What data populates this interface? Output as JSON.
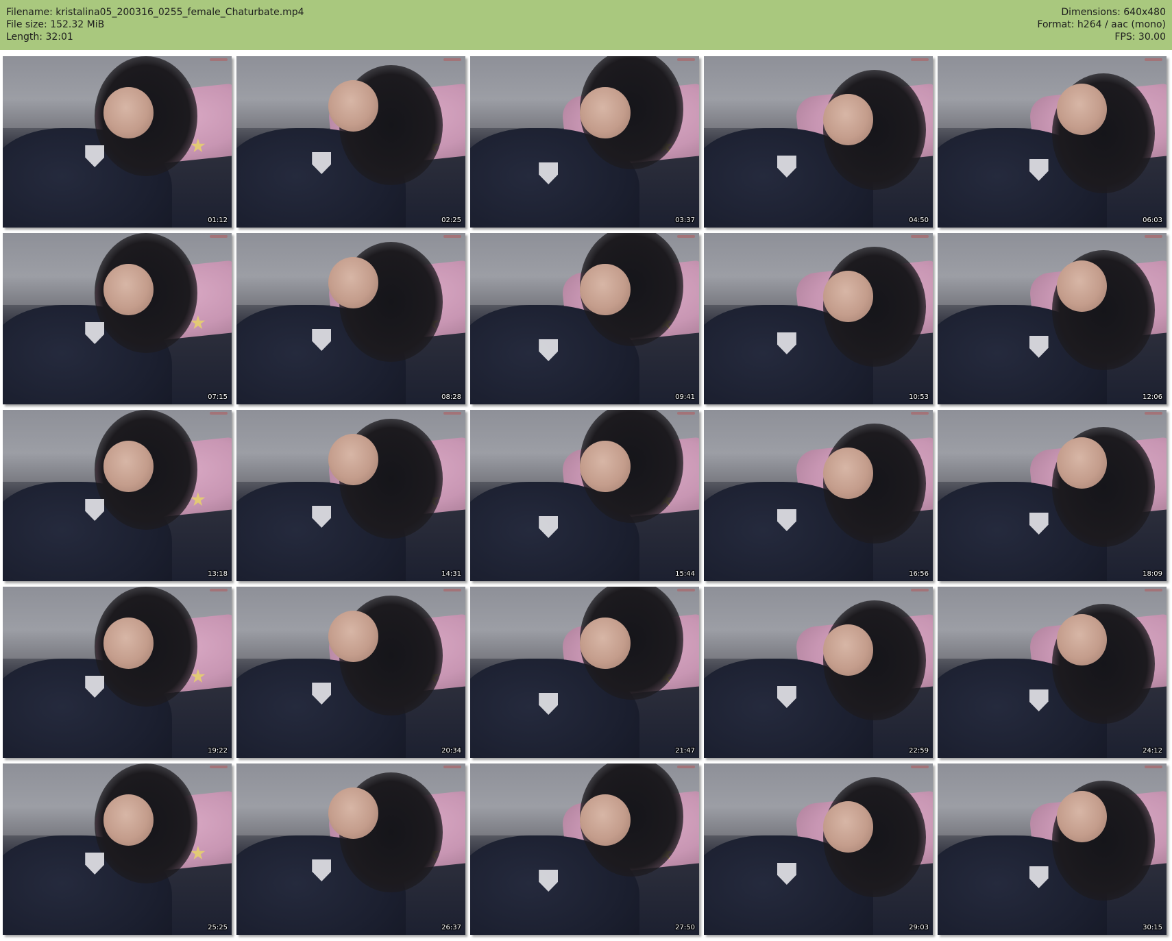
{
  "header": {
    "filename": "Filename: kristalina05_200316_0255_female_Chaturbate.mp4",
    "filesize": "File size: 152.32 MiB",
    "length": "Length: 32:01",
    "dimensions": "Dimensions: 640x480",
    "format": "Format: h264 / aac (mono)",
    "fps": "FPS: 30.00"
  },
  "colors": {
    "header_bg": "#a9c87e",
    "page_bg": "#ffffff"
  },
  "thumbnails": [
    {
      "time": "01:12"
    },
    {
      "time": "02:25"
    },
    {
      "time": "03:37"
    },
    {
      "time": "04:50"
    },
    {
      "time": "06:03"
    },
    {
      "time": "07:15"
    },
    {
      "time": "08:28"
    },
    {
      "time": "09:41"
    },
    {
      "time": "10:53"
    },
    {
      "time": "12:06"
    },
    {
      "time": "13:18"
    },
    {
      "time": "14:31"
    },
    {
      "time": "15:44"
    },
    {
      "time": "16:56"
    },
    {
      "time": "18:09"
    },
    {
      "time": "19:22"
    },
    {
      "time": "20:34"
    },
    {
      "time": "21:47"
    },
    {
      "time": "22:59"
    },
    {
      "time": "24:12"
    },
    {
      "time": "25:25"
    },
    {
      "time": "26:37"
    },
    {
      "time": "27:50"
    },
    {
      "time": "29:03"
    },
    {
      "time": "30:15"
    }
  ]
}
